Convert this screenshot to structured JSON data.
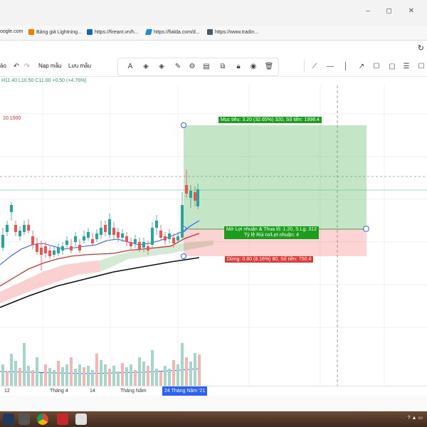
{
  "browser": {
    "tab_partial": "ảo",
    "bookmarks": [
      {
        "label": "oogle.com",
        "color": "#4285f4"
      },
      {
        "label": "Bảng giá Lightning...",
        "color": "#f57c00"
      },
      {
        "label": "https://fireant.vn/h...",
        "color": "#1565c0"
      },
      {
        "label": "https://fialda.com/d...",
        "color": "#1e88e5"
      },
      {
        "label": "https://www.tradin...",
        "color": "#455a64"
      }
    ]
  },
  "toolbar": {
    "nap_mau": "Nạp mẫu",
    "luu_mau": "Lưu mẫu",
    "left_label": "ảo"
  },
  "ohlc_text": "H11.40 L10.50 C11.00 +0.50 (+4.76%)",
  "price_level": "10.1500",
  "trade": {
    "target_label": "Mục tiêu: 3.20 (32.65%) 320, Số tiền: 1998.4",
    "pnl_line1": "Mở Lợi nhuận & Thua lỗ: 1.20, S.Lg: 312",
    "pnl_line2": "Tỷ lệ Rủi ro/Lợi nhuận: 4",
    "stop_label": "Dừng: 0.80 (8.16%) 80, Số tiền: 750.4",
    "profit_color": "#1b9e1b",
    "stop_color": "#e53935"
  },
  "xaxis": {
    "ticks": [
      "12",
      "Tháng 4",
      "14",
      "Tháng Năm"
    ],
    "cursor_label": "24 Tháng Năm '21"
  },
  "chart_data": {
    "type": "candlestick",
    "last_close": 11.0,
    "change": 0.5,
    "change_pct": 4.76,
    "high": 11.4,
    "low": 10.5,
    "entry": 9.8,
    "target": 13.0,
    "stop": 9.0
  }
}
